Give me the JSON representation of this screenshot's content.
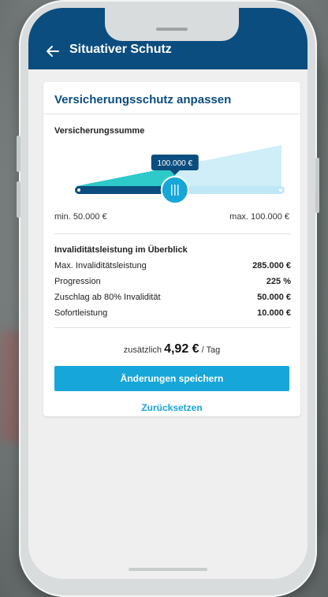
{
  "app": {
    "title": "Situativer Schutz"
  },
  "card": {
    "heading": "Versicherungsschutz anpassen",
    "section_label": "Versicherungssumme",
    "slider": {
      "value_label": "100.000 €",
      "fraction": 0.48,
      "min_label": "min. 50.000 €",
      "max_label": "max. 100.000 €"
    },
    "overview_title": "Invaliditätsleistung im Überblick",
    "rows": [
      {
        "label": "Max. Invaliditätsleistung",
        "value": "285.000 €"
      },
      {
        "label": "Progression",
        "value": "225 %"
      },
      {
        "label": "Zuschlag ab 80% Invalidität",
        "value": "50.000 €"
      },
      {
        "label": "Sofortleistung",
        "value": "10.000 €"
      }
    ],
    "price": {
      "prefix": "zusätzlich",
      "amount": "4,92 €",
      "suffix": "/ Tag"
    },
    "save_label": "Änderungen speichern",
    "reset_label": "Zurücksetzen"
  },
  "colors": {
    "primary": "#0b4d7f",
    "accent": "#17a6d9",
    "teal": "#2ec9c9"
  },
  "icons": {
    "back": "arrow-left-icon",
    "thumb": "grip-lines-icon"
  }
}
